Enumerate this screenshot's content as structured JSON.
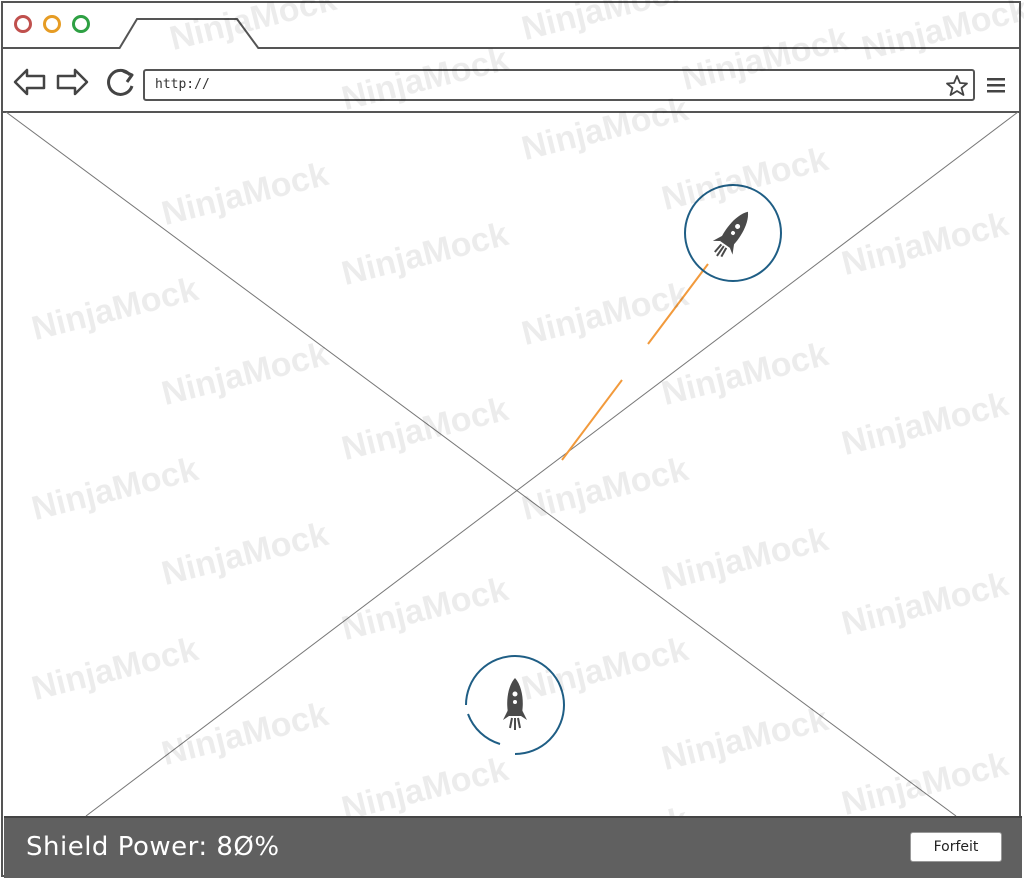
{
  "browser": {
    "url_text": "http://",
    "icons": {
      "back": "arrow-left-icon",
      "forward": "arrow-right-icon",
      "reload": "reload-icon",
      "bookmark": "star-icon",
      "menu": "hamburger-menu-icon"
    },
    "window_dots": {
      "close": "#c0504d",
      "minimize": "#e69c24",
      "maximize": "#2ea043"
    }
  },
  "game": {
    "enemy_ship_icon": "rocket-icon",
    "player_ship_icon": "rocket-icon",
    "ring_color": "#1f5e85",
    "laser_color": "#f29a3c"
  },
  "status": {
    "shield_label": "Shield Power: 8Ø%",
    "forfeit_label": "Forfeit"
  },
  "watermark": "NinjaMock"
}
